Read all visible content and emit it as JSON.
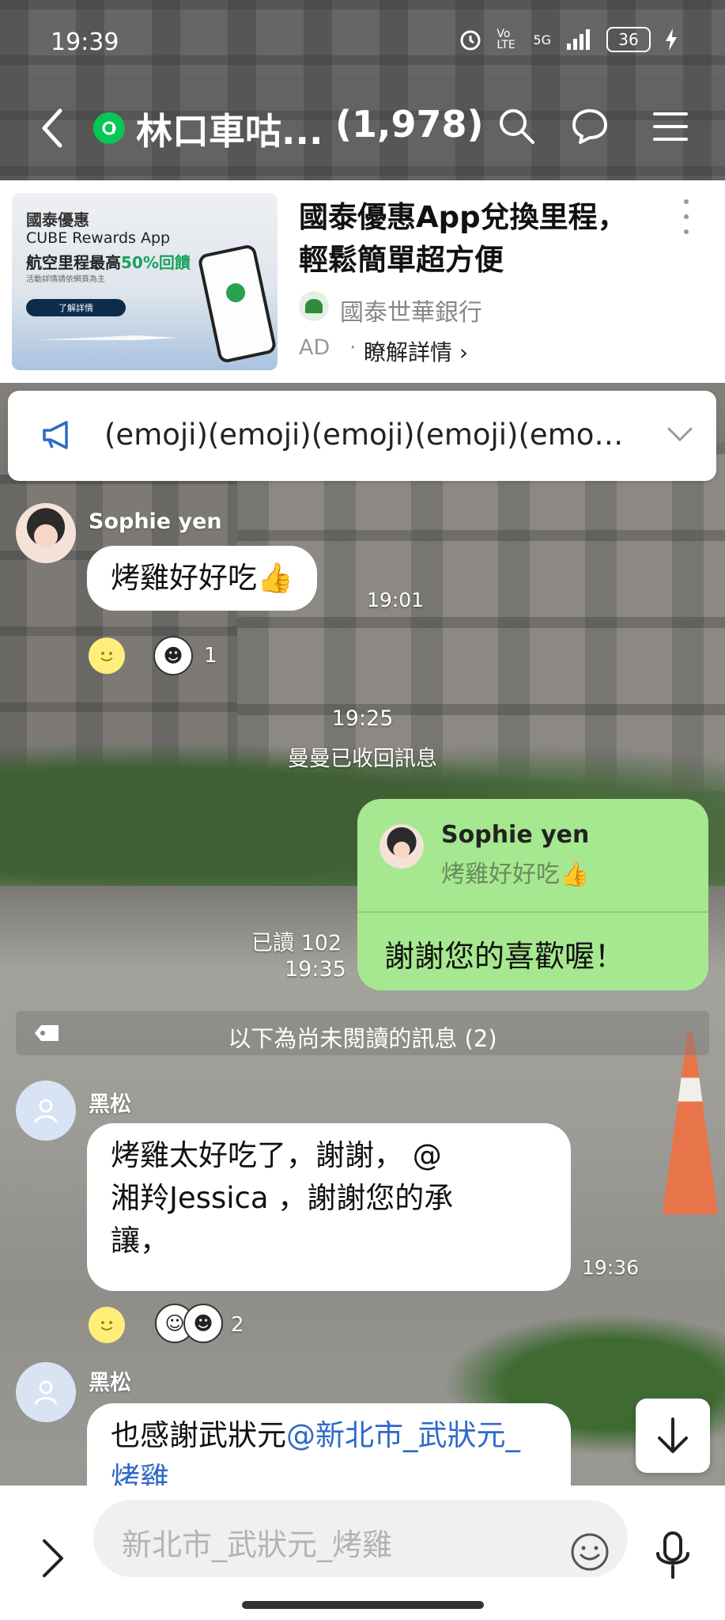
{
  "status_bar": {
    "time": "19:39",
    "network": "5G",
    "volte": "Vo LTE",
    "battery": "36"
  },
  "header": {
    "title": "林口車咕...",
    "member_count": "(1,978)",
    "badge_icon": "line-group-badge"
  },
  "ad": {
    "image": {
      "brand": "國泰優惠",
      "line1": "CUBE Rewards App",
      "line2_prefix": "航空里程最高",
      "line2_highlight": "50%回饋",
      "small": "活動詳情請依網頁為主",
      "cta": "了解詳情"
    },
    "title": "國泰優惠App兌換里程，輕鬆簡單超方便",
    "sponsor": "國泰世華銀行",
    "label": "AD",
    "separator": "·",
    "learn_more": "瞭解詳情 ›"
  },
  "announcement": {
    "text": "(emoji)(emoji)(emoji)(emoji)(emoji)(emoji)"
  },
  "messages": {
    "m1": {
      "sender": "Sophie yen",
      "text": "烤雞好好吃👍",
      "time": "19:01",
      "reaction_count": "1"
    },
    "system": {
      "time": "19:25",
      "text": "曼曼已收回訊息"
    },
    "mine": {
      "reply_name": "Sophie yen",
      "reply_text": "烤雞好好吃👍",
      "text": "謝謝您的喜歡喔！",
      "read": "已讀 102",
      "time": "19:35"
    },
    "unread_divider": "以下為尚未閱讀的訊息 (2)",
    "m2": {
      "sender": "黑松",
      "text_part1": "烤雞太好吃了，謝謝， @",
      "text_part2": "湘羚Jessica ，謝謝您的承",
      "text_part3": "讓，",
      "time": "19:36",
      "reaction_count": "2"
    },
    "m3": {
      "sender": "黑松",
      "text_plain": "也感謝武狀元",
      "mention": "@新北市_武狀元_烤雞"
    }
  },
  "input": {
    "placeholder": "新北市_武狀元_烤雞"
  }
}
